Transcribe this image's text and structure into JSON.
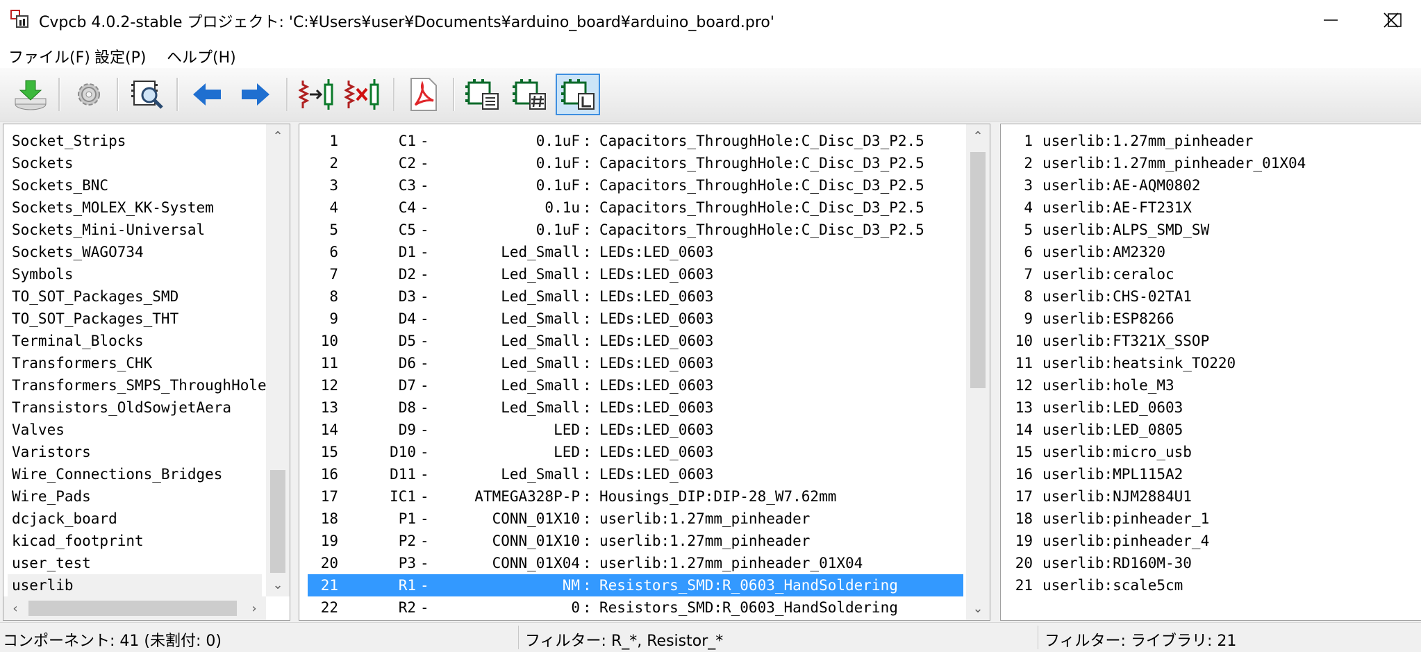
{
  "window": {
    "title": "Cvpcb 4.0.2-stable プロジェクト: 'C:¥Users¥user¥Documents¥arduino_board¥arduino_board.pro'"
  },
  "menu": [
    {
      "label": "ファイル(F)"
    },
    {
      "label": "設定(P)"
    },
    {
      "label": "ヘルプ(H)"
    }
  ],
  "toolbar": [
    {
      "name": "save-netlist-icon"
    },
    {
      "name": "settings-gear-icon"
    },
    {
      "name": "view-footprint-icon"
    },
    {
      "name": "previous-arrow-icon"
    },
    {
      "name": "next-arrow-icon"
    },
    {
      "name": "auto-associate-icon"
    },
    {
      "name": "delete-association-icon"
    },
    {
      "name": "pdf-document-icon"
    },
    {
      "name": "filter-keyword-icon"
    },
    {
      "name": "filter-pin-count-icon"
    },
    {
      "name": "filter-library-icon",
      "active": true
    }
  ],
  "libraries": [
    "Socket_Strips",
    "Sockets",
    "Sockets_BNC",
    "Sockets_MOLEX_KK-System",
    "Sockets_Mini-Universal",
    "Sockets_WAGO734",
    "Symbols",
    "TO_SOT_Packages_SMD",
    "TO_SOT_Packages_THT",
    "Terminal_Blocks",
    "Transformers_CHK",
    "Transformers_SMPS_ThroughHole",
    "Transistors_OldSowjetAera",
    "Valves",
    "Varistors",
    "Wire_Connections_Bridges",
    "Wire_Pads",
    "dcjack_board",
    "kicad_footprint",
    "user_test",
    "userlib"
  ],
  "libraries_selected_index": 20,
  "components": [
    {
      "num": "1",
      "ref": "C1",
      "value": "0.1uF",
      "footprint": "Capacitors_ThroughHole:C_Disc_D3_P2.5"
    },
    {
      "num": "2",
      "ref": "C2",
      "value": "0.1uF",
      "footprint": "Capacitors_ThroughHole:C_Disc_D3_P2.5"
    },
    {
      "num": "3",
      "ref": "C3",
      "value": "0.1uF",
      "footprint": "Capacitors_ThroughHole:C_Disc_D3_P2.5"
    },
    {
      "num": "4",
      "ref": "C4",
      "value": "0.1u",
      "footprint": "Capacitors_ThroughHole:C_Disc_D3_P2.5"
    },
    {
      "num": "5",
      "ref": "C5",
      "value": "0.1uF",
      "footprint": "Capacitors_ThroughHole:C_Disc_D3_P2.5"
    },
    {
      "num": "6",
      "ref": "D1",
      "value": "Led_Small",
      "footprint": "LEDs:LED_0603"
    },
    {
      "num": "7",
      "ref": "D2",
      "value": "Led_Small",
      "footprint": "LEDs:LED_0603"
    },
    {
      "num": "8",
      "ref": "D3",
      "value": "Led_Small",
      "footprint": "LEDs:LED_0603"
    },
    {
      "num": "9",
      "ref": "D4",
      "value": "Led_Small",
      "footprint": "LEDs:LED_0603"
    },
    {
      "num": "10",
      "ref": "D5",
      "value": "Led_Small",
      "footprint": "LEDs:LED_0603"
    },
    {
      "num": "11",
      "ref": "D6",
      "value": "Led_Small",
      "footprint": "LEDs:LED_0603"
    },
    {
      "num": "12",
      "ref": "D7",
      "value": "Led_Small",
      "footprint": "LEDs:LED_0603"
    },
    {
      "num": "13",
      "ref": "D8",
      "value": "Led_Small",
      "footprint": "LEDs:LED_0603"
    },
    {
      "num": "14",
      "ref": "D9",
      "value": "LED",
      "footprint": "LEDs:LED_0603"
    },
    {
      "num": "15",
      "ref": "D10",
      "value": "LED",
      "footprint": "LEDs:LED_0603"
    },
    {
      "num": "16",
      "ref": "D11",
      "value": "Led_Small",
      "footprint": "LEDs:LED_0603"
    },
    {
      "num": "17",
      "ref": "IC1",
      "value": "ATMEGA328P-P",
      "footprint": "Housings_DIP:DIP-28_W7.62mm"
    },
    {
      "num": "18",
      "ref": "P1",
      "value": "CONN_01X10",
      "footprint": "userlib:1.27mm_pinheader"
    },
    {
      "num": "19",
      "ref": "P2",
      "value": "CONN_01X10",
      "footprint": "userlib:1.27mm_pinheader"
    },
    {
      "num": "20",
      "ref": "P3",
      "value": "CONN_01X04",
      "footprint": "userlib:1.27mm_pinheader_01X04"
    },
    {
      "num": "21",
      "ref": "R1",
      "value": "NM",
      "footprint": "Resistors_SMD:R_0603_HandSoldering"
    },
    {
      "num": "22",
      "ref": "R2",
      "value": "0",
      "footprint": "Resistors_SMD:R_0603_HandSoldering"
    }
  ],
  "components_selected_index": 20,
  "footprints": [
    {
      "num": "1",
      "name": "userlib:1.27mm_pinheader"
    },
    {
      "num": "2",
      "name": "userlib:1.27mm_pinheader_01X04"
    },
    {
      "num": "3",
      "name": "userlib:AE-AQM0802"
    },
    {
      "num": "4",
      "name": "userlib:AE-FT231X"
    },
    {
      "num": "5",
      "name": "userlib:ALPS_SMD_SW"
    },
    {
      "num": "6",
      "name": "userlib:AM2320"
    },
    {
      "num": "7",
      "name": "userlib:ceraloc"
    },
    {
      "num": "8",
      "name": "userlib:CHS-02TA1"
    },
    {
      "num": "9",
      "name": "userlib:ESP8266"
    },
    {
      "num": "10",
      "name": "userlib:FT321X_SSOP"
    },
    {
      "num": "11",
      "name": "userlib:heatsink_TO220"
    },
    {
      "num": "12",
      "name": "userlib:hole_M3"
    },
    {
      "num": "13",
      "name": "userlib:LED_0603"
    },
    {
      "num": "14",
      "name": "userlib:LED_0805"
    },
    {
      "num": "15",
      "name": "userlib:micro_usb"
    },
    {
      "num": "16",
      "name": "userlib:MPL115A2"
    },
    {
      "num": "17",
      "name": "userlib:NJM2884U1"
    },
    {
      "num": "18",
      "name": "userlib:pinheader_1"
    },
    {
      "num": "19",
      "name": "userlib:pinheader_4"
    },
    {
      "num": "20",
      "name": "userlib:RD160M-30"
    },
    {
      "num": "21",
      "name": "userlib:scale5cm"
    }
  ],
  "status": {
    "components": "コンポーネント: 41 (未割付: 0)",
    "filter": "フィルター: R_*, Resistor_*",
    "library_filter": "フィルター: ライブラリ: 21"
  },
  "colors": {
    "selection": "#3399ff",
    "accent_blue": "#1f6fd0",
    "pdf_red": "#e0262a"
  }
}
